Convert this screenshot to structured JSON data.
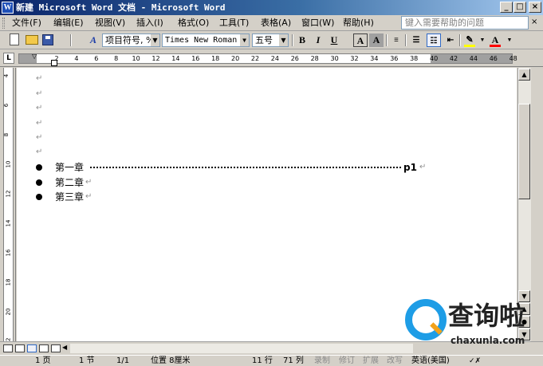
{
  "window": {
    "title": "新建 Microsoft Word 文档 - Microsoft Word",
    "minimize_label": "_",
    "maximize_label": "□",
    "close_label": "×"
  },
  "menubar": {
    "items": [
      "文件(F)",
      "编辑(E)",
      "视图(V)",
      "插入(I)",
      "格式(O)",
      "工具(T)",
      "表格(A)",
      "窗口(W)",
      "帮助(H)"
    ],
    "help_placeholder": "键入需要帮助的问题",
    "close_doc_label": "×"
  },
  "toolbar": {
    "style_value": "项目符号, %",
    "font_value": "Times New Roman",
    "size_value": "五号",
    "bold_label": "B",
    "italic_label": "I",
    "underline_label": "U",
    "border_label": "A",
    "shade_label": "A",
    "fontcolor_label": "A",
    "highlight_color": "#ffff00",
    "fontcolor_color": "#ff0000"
  },
  "ruler": {
    "corner_label": "L",
    "marks": [
      "2",
      "4",
      "6",
      "8",
      "10",
      "12",
      "14",
      "16",
      "18",
      "20",
      "22",
      "24",
      "26",
      "28",
      "30",
      "32",
      "34",
      "36",
      "38",
      "40",
      "42",
      "44",
      "46",
      "48"
    ],
    "vertical_marks": [
      "4",
      "6",
      "8",
      "10",
      "12",
      "14",
      "16",
      "18",
      "20",
      "22"
    ]
  },
  "document": {
    "paragraph_mark": "↵",
    "toc_entries": [
      {
        "text": "第一章",
        "page": "p1"
      },
      {
        "text": "第二章"
      },
      {
        "text": "第三章"
      }
    ]
  },
  "statusbar": {
    "page": "1 页",
    "section": "1 节",
    "page_of": "1/1",
    "position": "位置 8厘米",
    "line": "11 行",
    "column": "71 列",
    "rec": "录制",
    "trk": "修订",
    "ext": "扩展",
    "ovr": "改写",
    "language": "英语(美国)"
  },
  "watermark": {
    "text": "查询啦",
    "url": "chaxunla.com"
  }
}
